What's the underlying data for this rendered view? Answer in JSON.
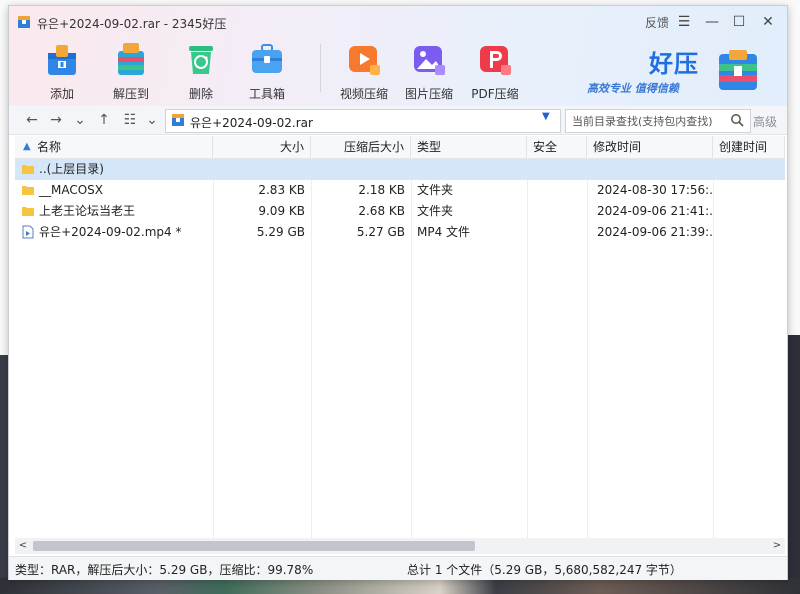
{
  "window": {
    "title": "유은+2024-09-02.rar - 2345好压",
    "feedback": "反馈"
  },
  "toolbar": [
    {
      "label": "添加",
      "icon": "add-archive-icon"
    },
    {
      "label": "解压到",
      "icon": "extract-icon"
    },
    {
      "label": "删除",
      "icon": "delete-recycle-icon"
    },
    {
      "label": "工具箱",
      "icon": "toolbox-icon"
    },
    {
      "label": "视频压缩",
      "icon": "video-compress-icon"
    },
    {
      "label": "图片压缩",
      "icon": "image-compress-icon"
    },
    {
      "label": "PDF压缩",
      "icon": "pdf-compress-icon"
    }
  ],
  "brand": {
    "name": "好压",
    "slogan": "高效专业  值得信赖"
  },
  "nav": {
    "path": "유은+2024-09-02.rar",
    "search_placeholder": "当前目录查找(支持包内查找)",
    "advanced": "高级"
  },
  "columns": [
    "名称",
    "大小",
    "压缩后大小",
    "类型",
    "安全",
    "修改时间",
    "创建时间"
  ],
  "files": [
    {
      "name": "..(上层目录)",
      "size": "",
      "packed": "",
      "type": "",
      "modified": "",
      "icon": "folder-up-icon"
    },
    {
      "name": "__MACOSX",
      "size": "2.83 KB",
      "packed": "2.18 KB",
      "type": "文件夹",
      "modified": "2024-08-30 17:56:...",
      "icon": "folder-icon"
    },
    {
      "name": "上老王论坛当老王",
      "size": "9.09 KB",
      "packed": "2.68 KB",
      "type": "文件夹",
      "modified": "2024-09-06 21:41:...",
      "icon": "folder-icon"
    },
    {
      "name": "유은+2024-09-02.mp4 *",
      "size": "5.29 GB",
      "packed": "5.27 GB",
      "type": "MP4 文件",
      "modified": "2024-09-06 21:39:...",
      "icon": "video-file-icon"
    }
  ],
  "status": {
    "left": "类型：RAR，解压后大小：5.29 GB，压缩比：99.78%",
    "right": "总计 1 个文件（5.29 GB，5,680,582,247 字节）"
  },
  "colors": {
    "accent": "#1f6fe0",
    "selected_row": "#d5e6f8",
    "folder": "#f5c542"
  }
}
